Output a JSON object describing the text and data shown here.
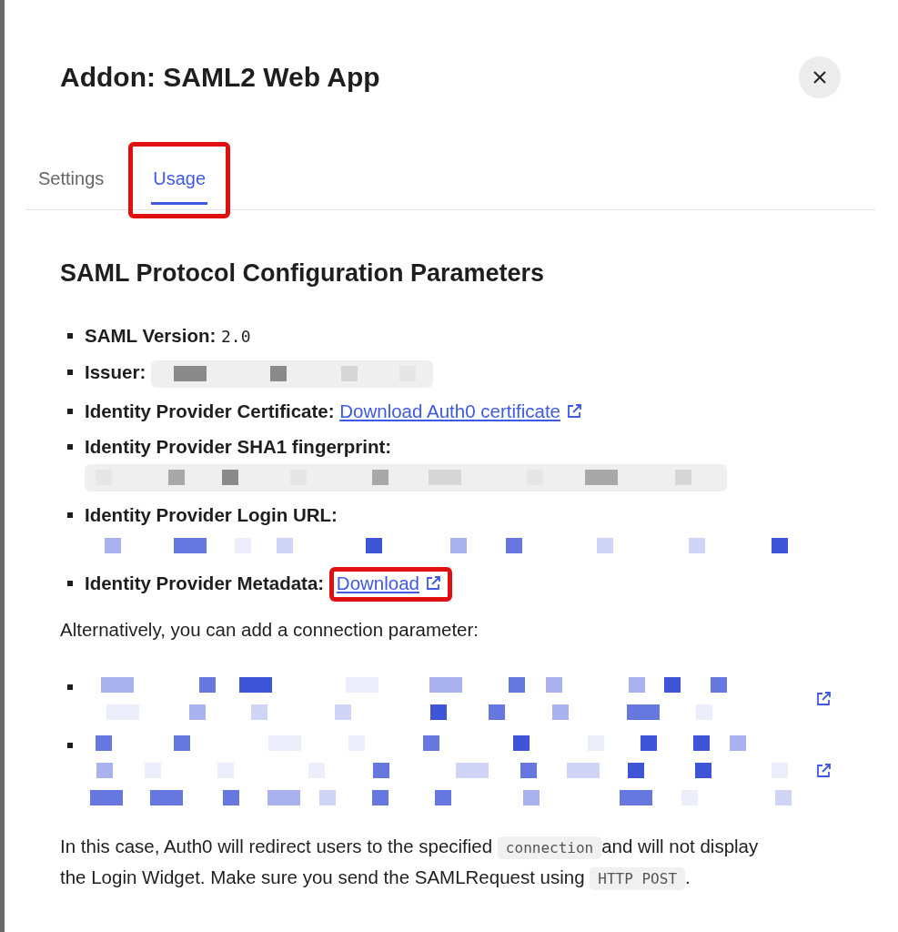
{
  "dialog": {
    "title": "Addon: SAML2 Web App"
  },
  "tabs": [
    {
      "label": "Settings",
      "selected": false,
      "highlighted": false
    },
    {
      "label": "Usage",
      "selected": true,
      "highlighted": true
    }
  ],
  "section": {
    "heading": "SAML Protocol Configuration Parameters",
    "parameters": [
      {
        "kind": "text",
        "label": "SAML Version:",
        "value": "2.0"
      },
      {
        "kind": "masked_code",
        "label": "Issuer:",
        "value_below": false
      },
      {
        "kind": "link",
        "label": "Identity Provider Certificate:",
        "link": "Download Auth0 certificate",
        "highlighted": false
      },
      {
        "kind": "masked_code",
        "label": "Identity Provider SHA1 fingerprint:",
        "value_below": true
      },
      {
        "kind": "masked_link",
        "label": "Identity Provider Login URL:",
        "value_below": true
      },
      {
        "kind": "link",
        "label": "Identity Provider Metadata:",
        "link": "Download",
        "highlighted": true
      }
    ]
  },
  "alternative": {
    "intro": "Alternatively, you can add a connection parameter:",
    "links": [
      {
        "kind": "masked_link"
      },
      {
        "kind": "masked_link"
      }
    ]
  },
  "note": [
    {
      "kind": "text",
      "text": "In this case, Auth0 will redirect users to the specified "
    },
    {
      "kind": "code",
      "text": "connection"
    },
    {
      "kind": "text",
      "text": "and will not display the Login Widget. Make sure you send the SAMLRequest using "
    },
    {
      "kind": "code",
      "text": "HTTP POST"
    },
    {
      "kind": "text",
      "text": "."
    }
  ]
}
